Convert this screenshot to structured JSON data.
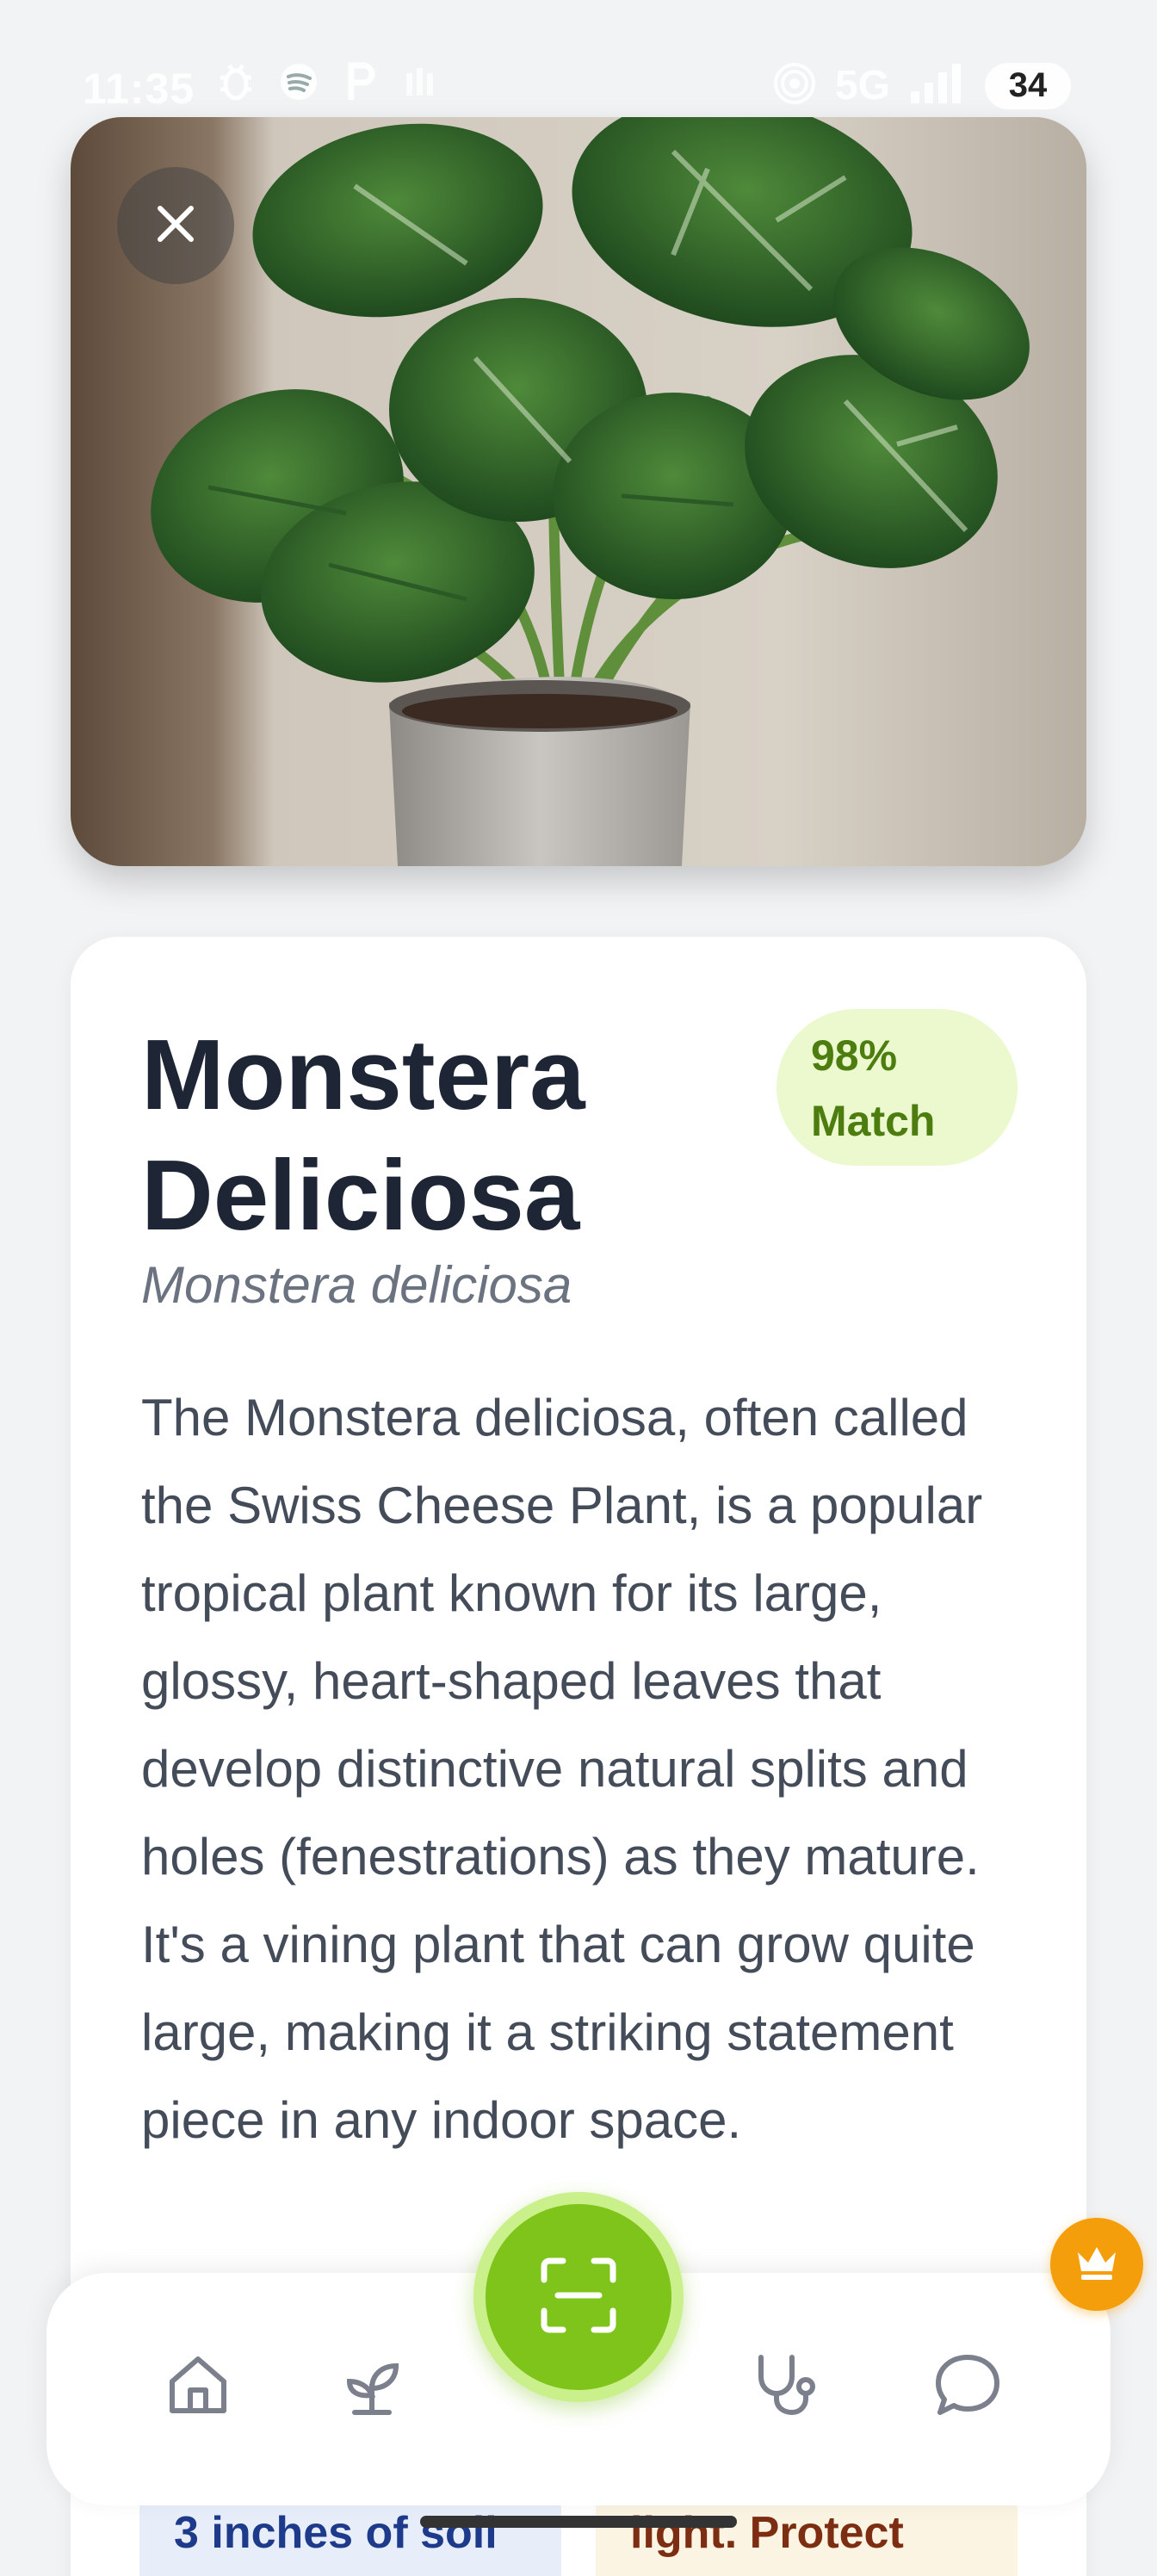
{
  "status_bar": {
    "time": "11:35",
    "network": "5G",
    "battery": "34",
    "left_icons": [
      "bug-icon",
      "spotify-icon",
      "parking-icon",
      "signal-bars-icon"
    ],
    "right_icons": [
      "hotspot-icon",
      "cellular-signal-icon",
      "battery-icon"
    ]
  },
  "hero": {
    "close_icon": "close-icon"
  },
  "plant": {
    "name": "Monstera Deliciosa",
    "scientific_name": "Monstera deliciosa",
    "match_badge": "98% Match",
    "description": "The Monstera deliciosa, often called the Swiss Cheese Plant, is a popular tropical plant known for its large, glossy, heart-shaped leaves that develop distinctive natural splits and holes (fenestrations) as they mature. It's a vining plant that can grow quite large, making it a striking statement piece in any indoor space."
  },
  "tips": {
    "soil_partial": "3 inches of soil",
    "light_partial": "light. Protect"
  },
  "bottom_nav": {
    "items": [
      "home-icon",
      "sprout-icon",
      "stethoscope-icon",
      "chat-bubble-icon"
    ],
    "scan_icon": "scan-icon",
    "premium_icon": "crown-icon"
  },
  "colors": {
    "accent_green": "#7fc41a",
    "badge_bg": "#ecf9cf",
    "badge_text": "#4d7c0f",
    "premium": "#f59e0b",
    "title": "#1e2636"
  }
}
